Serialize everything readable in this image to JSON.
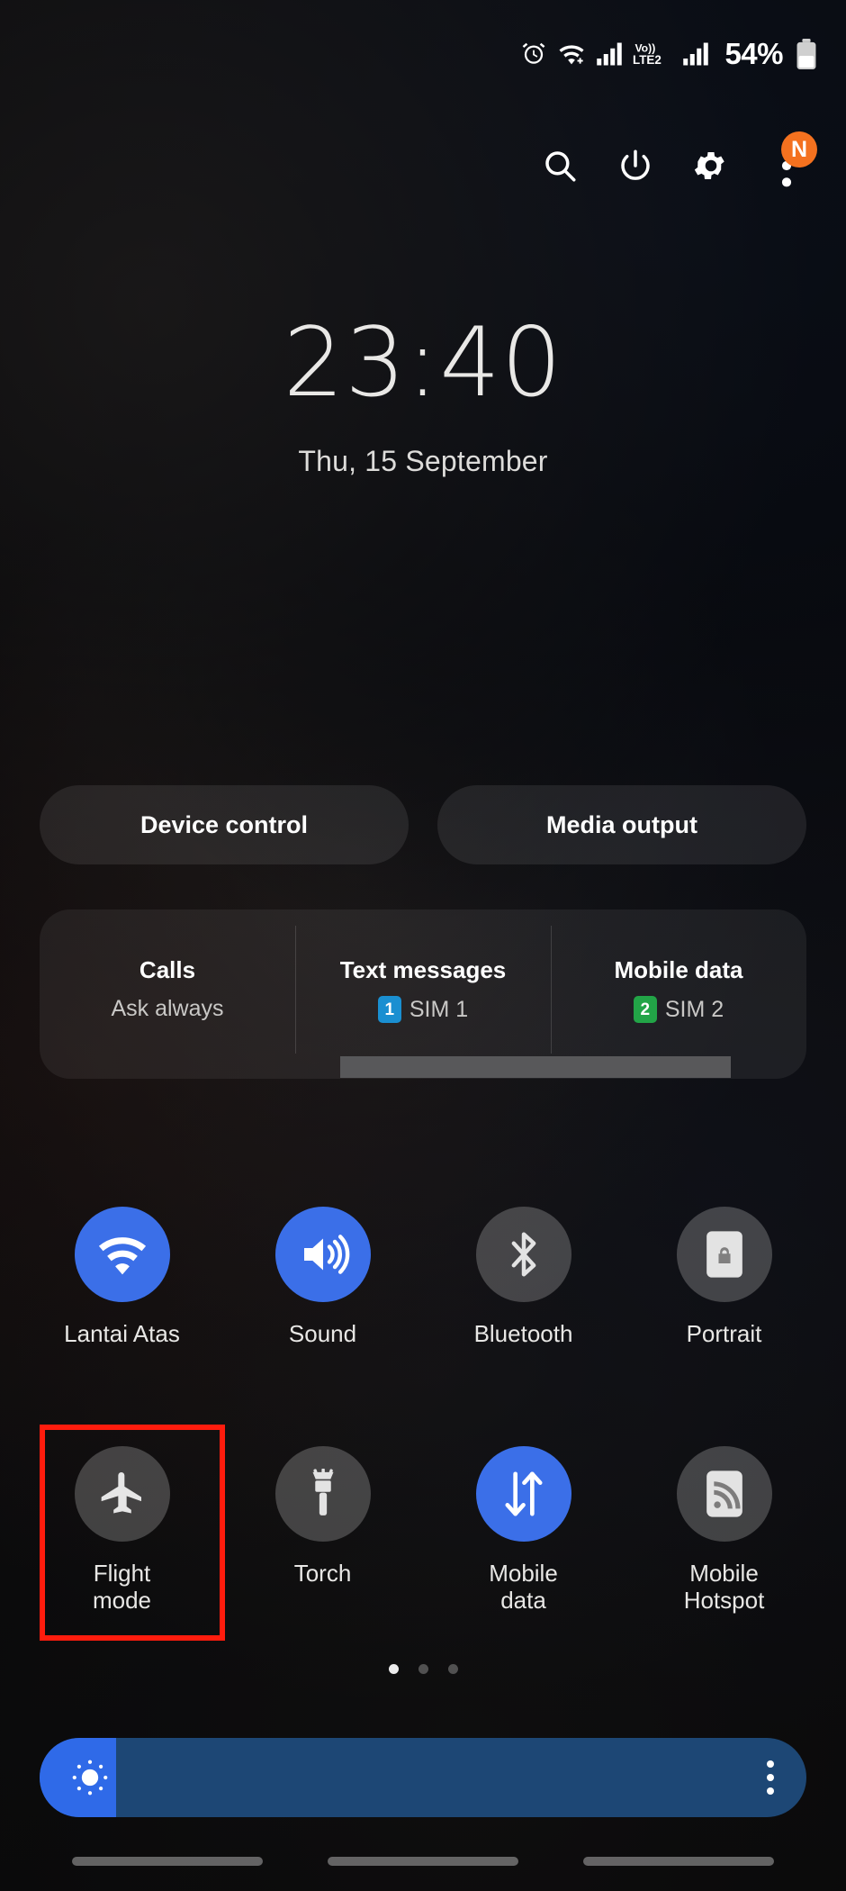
{
  "status_bar": {
    "battery_percent": "54%",
    "icons": [
      "alarm-icon",
      "wifi-icon",
      "signal-bars-icon",
      "volte2-icon",
      "signal-bars-2-icon",
      "battery-icon"
    ],
    "network_label": "Vo))",
    "network_label2": "LTE2"
  },
  "header": {
    "search_label": "search-icon",
    "power_label": "power-icon",
    "settings_label": "gear-icon",
    "more_label": "three-dot-menu-icon",
    "badge": "N",
    "badge_color": "#f4711f"
  },
  "clock": {
    "time": "23:40",
    "date": "Thu, 15 September"
  },
  "shortcuts": [
    {
      "label": "Device control"
    },
    {
      "label": "Media output"
    }
  ],
  "sim_panel": {
    "columns": [
      {
        "title": "Calls",
        "value": "Ask always",
        "chip": "",
        "chip_color": ""
      },
      {
        "title": "Text messages",
        "value": "SIM 1",
        "chip": "1",
        "chip_color": "#1a8fd1"
      },
      {
        "title": "Mobile data",
        "value": "SIM 2",
        "chip": "2",
        "chip_color": "#22a447"
      }
    ]
  },
  "quick_toggles": {
    "accent_on": "#3b6fe8",
    "accent_off": "rgba(190,190,190,0.30)",
    "row1": [
      {
        "label": "Lantai Atas",
        "icon": "wifi-icon",
        "state": "on"
      },
      {
        "label": "Sound",
        "icon": "sound-icon",
        "state": "on"
      },
      {
        "label": "Bluetooth",
        "icon": "bluetooth-icon",
        "state": "off"
      },
      {
        "label": "Portrait",
        "icon": "portrait-rotation-icon",
        "state": "off"
      }
    ],
    "row2": [
      {
        "label": "Flight\nmode",
        "icon": "airplane-icon",
        "state": "off",
        "highlighted": true
      },
      {
        "label": "Torch",
        "icon": "flashlight-icon",
        "state": "off"
      },
      {
        "label": "Mobile\ndata",
        "icon": "mobile-data-arrows-icon",
        "state": "on"
      },
      {
        "label": "Mobile\nHotspot",
        "icon": "hotspot-icon",
        "state": "off"
      }
    ]
  },
  "pager": {
    "total": 3,
    "active_index": 0
  },
  "brightness": {
    "level_percent": 10,
    "track_color": "#1d4775",
    "fill_color": "#2f6ae8",
    "sun_icon": "brightness-sun-icon",
    "menu_icon": "three-dot-menu-icon"
  },
  "highlight": {
    "target": "Flight mode",
    "color": "#ff1c0d"
  },
  "nav_bar": {
    "hints": [
      "nav-hint-left",
      "nav-hint-center",
      "nav-hint-right"
    ]
  }
}
